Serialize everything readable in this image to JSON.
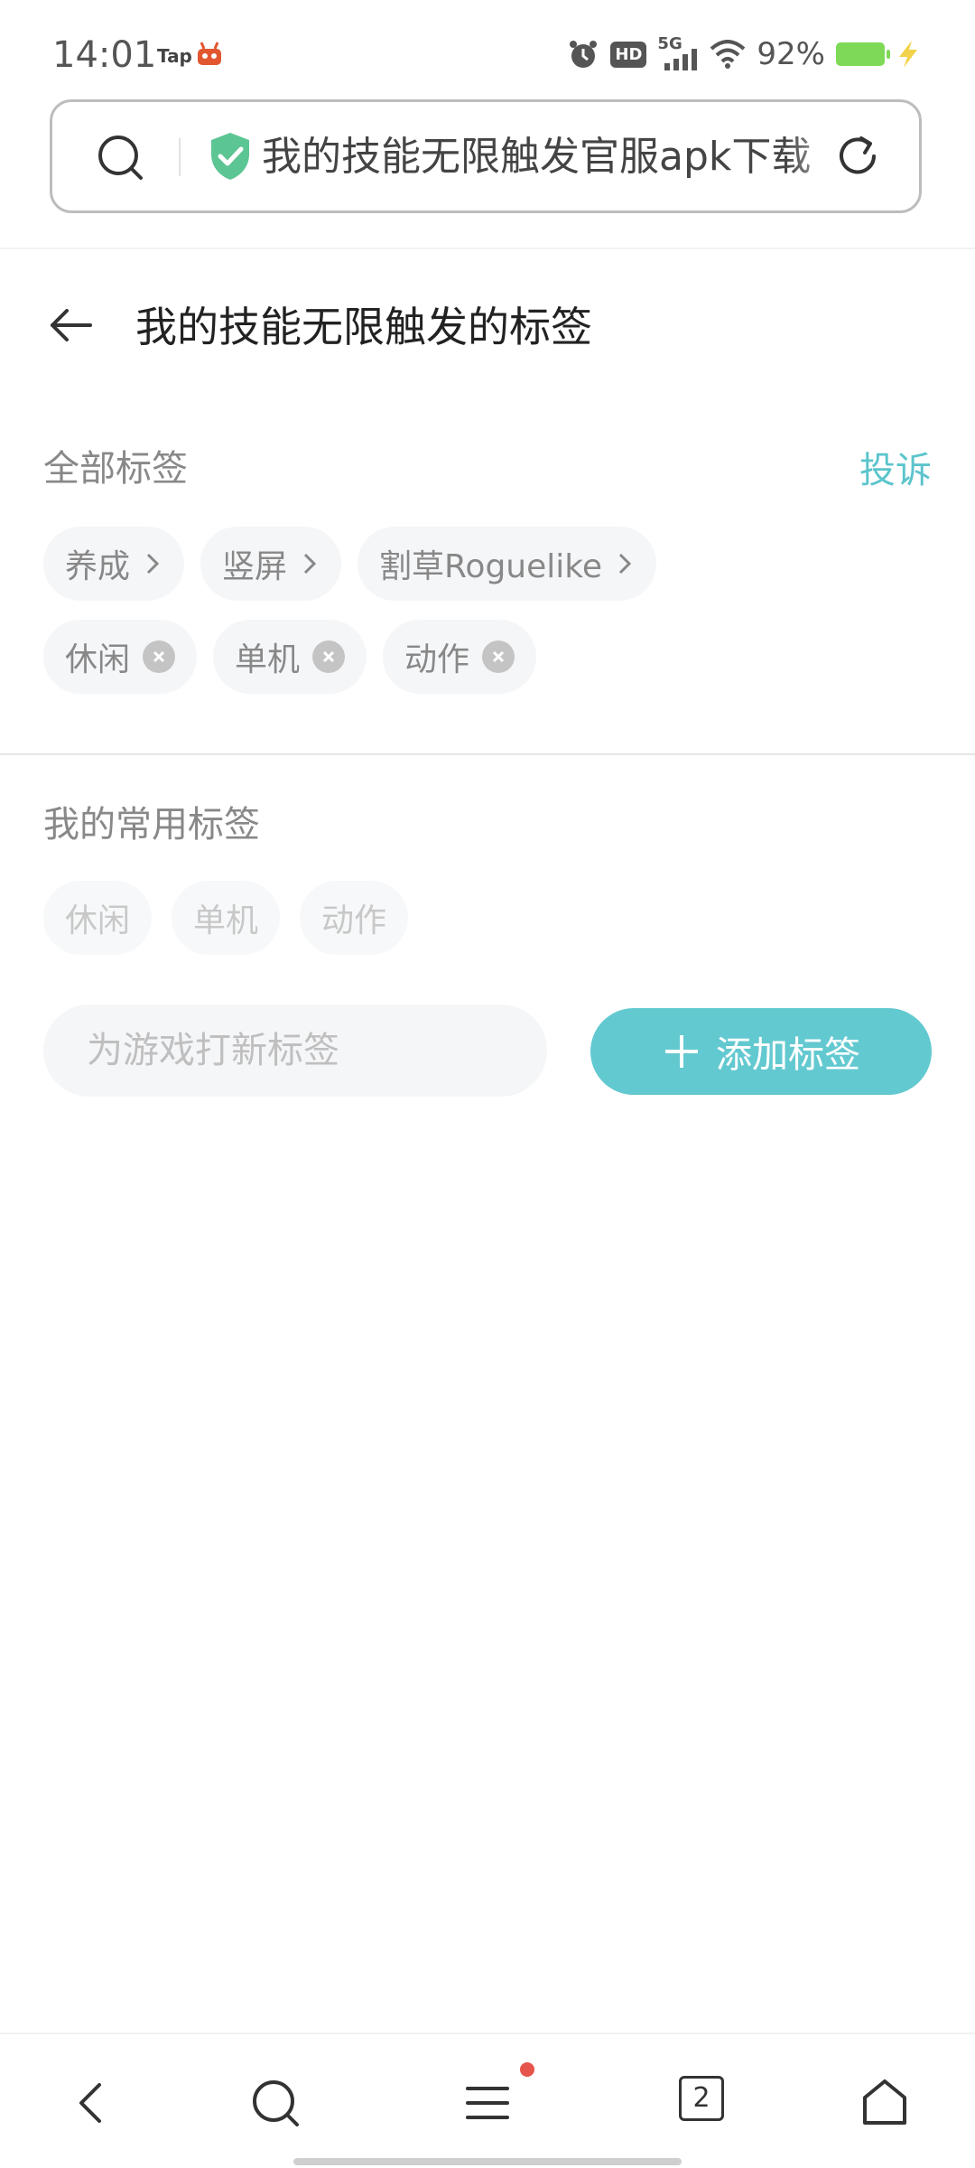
{
  "status_bar": {
    "time": "14:01",
    "app_label": "Tap",
    "network": "5G",
    "hd": "HD",
    "battery": "92%"
  },
  "address_bar": {
    "url": "我的技能无限触发官服apk下载"
  },
  "header": {
    "title": "我的技能无限触发的标签"
  },
  "all_tags": {
    "label": "全部标签",
    "report": "投诉",
    "category_tags": [
      "养成",
      "竖屏",
      "割草Roguelike"
    ],
    "user_tags": [
      "休闲",
      "单机",
      "动作"
    ]
  },
  "common_tags": {
    "label": "我的常用标签",
    "tags": [
      "休闲",
      "单机",
      "动作"
    ]
  },
  "add_tag": {
    "placeholder": "为游戏打新标签",
    "button": "添加标签"
  },
  "bottom_nav": {
    "tab_count": "2"
  },
  "colors": {
    "accent": "#63c9d0",
    "report": "#5bc4cc",
    "battery": "#7ed957",
    "badge": "#e5554b"
  }
}
